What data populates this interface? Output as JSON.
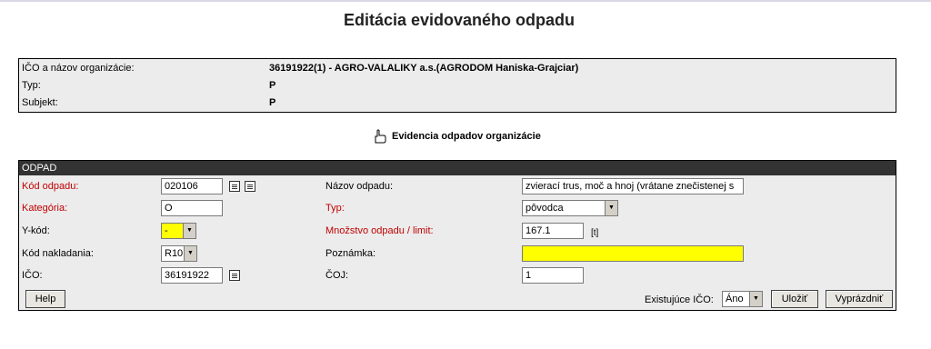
{
  "page": {
    "title": "Editácia evidovaného odpadu"
  },
  "org": {
    "ico_label": "IČO a názov organizácie:",
    "ico_value": "36191922(1) - AGRO-VALALIKY a.s.(AGRODOM Haniska-Grajciar)",
    "typ_label": "Typ:",
    "typ_value": "P",
    "subjekt_label": "Subjekt:",
    "subjekt_value": "P"
  },
  "evidencia_link": {
    "label": "Evidencia odpadov organizácie",
    "icon": "back-hand-icon"
  },
  "odpad": {
    "header": "ODPAD",
    "kod_odpadu": {
      "label": "Kód odpadu:",
      "value": "020106"
    },
    "kategoria": {
      "label": "Kategória:",
      "value": "O"
    },
    "y_kod": {
      "label": "Y-kód:",
      "value": "-"
    },
    "kod_nakladania": {
      "label": "Kód nakladania:",
      "value": "R10"
    },
    "ico": {
      "label": "IČO:",
      "value": "36191922"
    },
    "nazov_odpadu": {
      "label": "Názov odpadu:",
      "value": "zvierací trus, moč a hnoj (vrátane znečistenej s"
    },
    "typ": {
      "label": "Typ:",
      "value": "pôvodca"
    },
    "mnozstvo": {
      "label": "Množstvo odpadu / limit:",
      "value": "167.1",
      "unit": "[t]"
    },
    "poznamka": {
      "label": "Poznámka:",
      "value": ""
    },
    "coj": {
      "label": "ČOJ:",
      "value": "1"
    }
  },
  "footer": {
    "help_label": "Help",
    "existujuce_ico_label": "Existujúce IČO:",
    "existujuce_ico_value": "Áno",
    "ulozit_label": "Uložiť",
    "vyprazdnit_label": "Vyprázdniť"
  },
  "colors": {
    "required_label": "#c00000",
    "header_bar": "#333333",
    "highlight_input": "#ffff00",
    "panel_bg": "#ececec"
  }
}
